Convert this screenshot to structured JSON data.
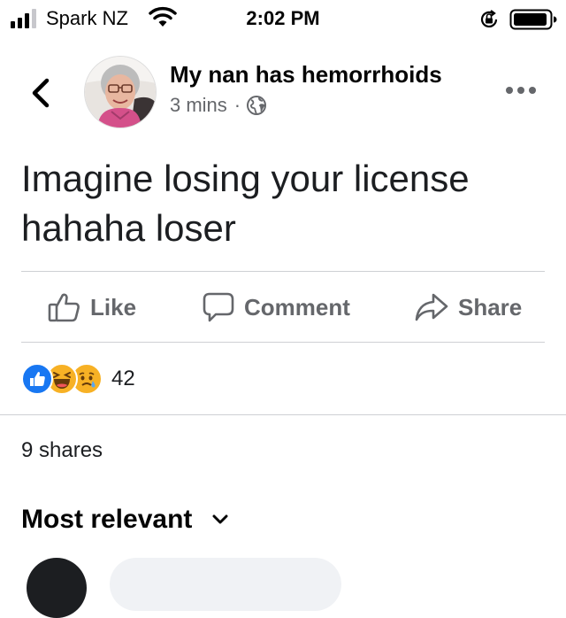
{
  "status_bar": {
    "carrier": "Spark NZ",
    "time": "2:02 PM"
  },
  "post": {
    "author": "My nan has hemorrhoids",
    "time_ago": "3 mins",
    "separator": "·",
    "text": "Imagine losing your license hahaha loser",
    "privacy_icon": "globe-icon"
  },
  "actions": {
    "like": "Like",
    "comment": "Comment",
    "share": "Share"
  },
  "reactions": {
    "icons": [
      "like-reaction-icon",
      "haha-reaction-icon",
      "sad-reaction-icon"
    ],
    "count": "42"
  },
  "shares_text": "9 shares",
  "comments": {
    "sort_label": "Most relevant"
  },
  "colors": {
    "accent": "#1877f2",
    "secondary_text": "#65676b",
    "divider": "#ced0d4"
  }
}
